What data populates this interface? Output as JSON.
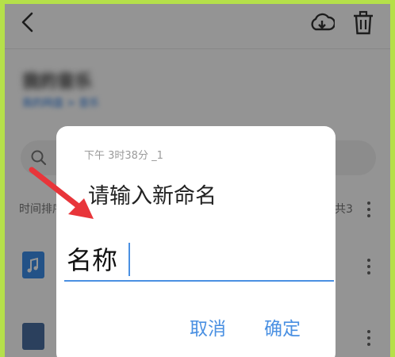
{
  "folder": {
    "title": "我的音乐",
    "path": "我的网盘 > 音乐"
  },
  "list": {
    "sort_label": "时间排序",
    "count_label": "共3"
  },
  "dialog": {
    "time_text": "下午 3时38分 _1",
    "title": "请输入新命名",
    "input_value": "名称",
    "cancel_label": "取消",
    "ok_label": "确定"
  },
  "colors": {
    "accent": "#4a90e2",
    "arrow": "#e8353a",
    "frame": "#b5e04a"
  }
}
